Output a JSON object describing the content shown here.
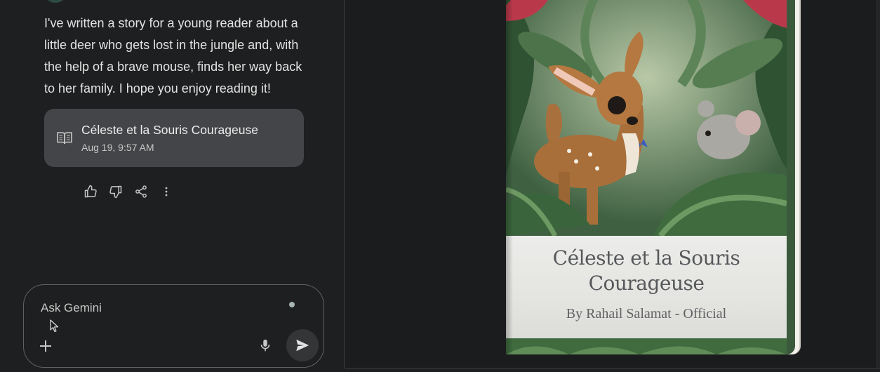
{
  "chat": {
    "message": "I've written a story for a young reader about a little deer who gets lost in the jungle and, with the help of a brave mouse, finds her way back to her family. I hope you enjoy reading it!",
    "document": {
      "title": "Céleste et la Souris Courageuse",
      "date": "Aug 19, 9:57 AM",
      "icon": "book-icon"
    },
    "actions": [
      "thumbs-up-icon",
      "thumbs-down-icon",
      "share-icon",
      "more-vert-icon"
    ]
  },
  "input": {
    "placeholder": "Ask Gemini"
  },
  "book": {
    "title_line1": "Céleste et la Souris",
    "title_line2": "Courageuse",
    "author": "By Rahail Salamat - Official"
  },
  "colors": {
    "background": "#1e1f20",
    "card": "#444548",
    "book_band": "#e6e6e3",
    "jungle": "#3b5a3c"
  }
}
